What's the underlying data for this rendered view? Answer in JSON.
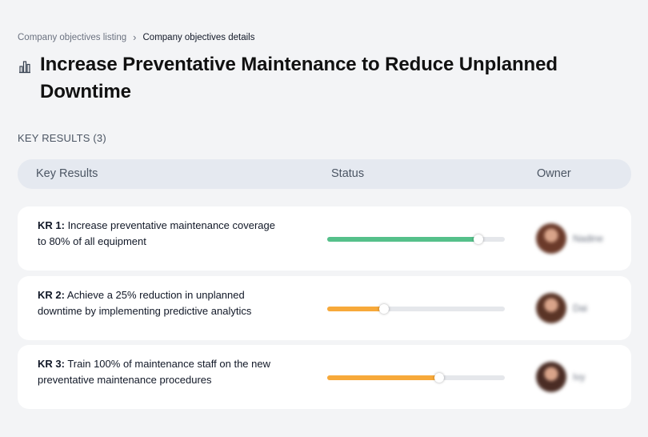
{
  "breadcrumb": {
    "parent": "Company objectives listing",
    "separator": "›",
    "current": "Company objectives details"
  },
  "page": {
    "icon": "building-chart-icon",
    "title": "Increase Preventative Maintenance to Reduce Unplanned Downtime"
  },
  "section": {
    "label": "KEY RESULTS (3)"
  },
  "table": {
    "headers": {
      "key_results": "Key Results",
      "status": "Status",
      "owner": "Owner"
    }
  },
  "key_results": [
    {
      "code": "KR 1:",
      "text": " Increase preventative maintenance coverage to 80% of all equipment",
      "progress": 0.85,
      "bar_color": "#55c08a",
      "owner": {
        "name": "Nadine",
        "avatar_color": "#6b3a2a"
      }
    },
    {
      "code": "KR 2:",
      "text": " Achieve a 25% reduction in unplanned downtime by implementing predictive analytics",
      "progress": 0.32,
      "bar_color": "#f7a93a",
      "owner": {
        "name": "Dai",
        "avatar_color": "#5a3426"
      }
    },
    {
      "code": "KR 3:",
      "text": " Train 100% of maintenance staff on the new preventative maintenance procedures",
      "progress": 0.63,
      "bar_color": "#f7a93a",
      "owner": {
        "name": "Ivy",
        "avatar_color": "#4a2c24"
      }
    }
  ],
  "colors": {
    "background": "#f3f4f6",
    "header_bg": "#e5e9f0",
    "track": "#e5e7eb"
  }
}
